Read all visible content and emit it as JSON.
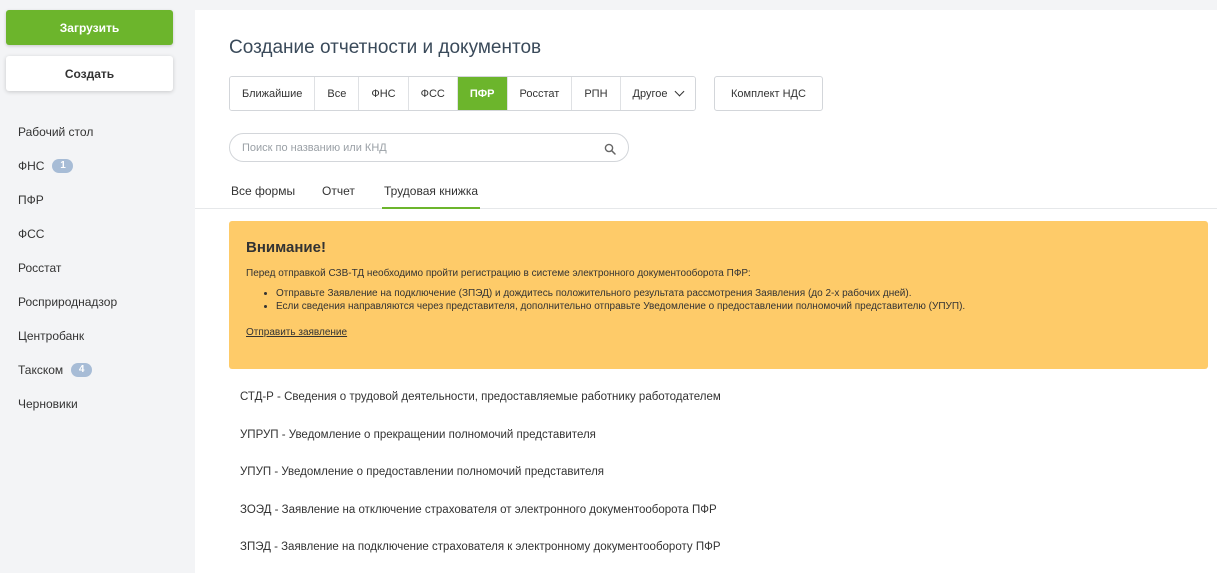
{
  "sidebar": {
    "upload_label": "Загрузить",
    "create_label": "Создать",
    "items": [
      {
        "label": "Рабочий стол",
        "badge": ""
      },
      {
        "label": "ФНС",
        "badge": "1"
      },
      {
        "label": "ПФР",
        "badge": ""
      },
      {
        "label": "ФСС",
        "badge": ""
      },
      {
        "label": "Росстат",
        "badge": ""
      },
      {
        "label": "Росприроднадзор",
        "badge": ""
      },
      {
        "label": "Центробанк",
        "badge": ""
      },
      {
        "label": "Такском",
        "badge": "4"
      },
      {
        "label": "Черновики",
        "badge": ""
      }
    ]
  },
  "main": {
    "title": "Создание отчетности и документов",
    "tabs": [
      "Ближайшие",
      "Все",
      "ФНС",
      "ФСС",
      "ПФР",
      "Росстат",
      "РПН",
      "Другое"
    ],
    "active_tab": "ПФР",
    "vat_tab": "Комплект НДС",
    "search_placeholder": "Поиск по названию или КНД",
    "subtabs": [
      "Все формы",
      "Отчет",
      "Трудовая книжка"
    ],
    "active_subtab": "Трудовая книжка",
    "alert": {
      "title": "Внимание!",
      "text": "Перед отправкой СЗВ-ТД необходимо пройти регистрацию в системе электронного документооборота ПФР:",
      "items": [
        "Отправьте Заявление на подключение (ЗПЭД) и дождитесь положительного результата рассмотрения Заявления (до 2-х рабочих дней).",
        "Если сведения направляются через представителя, дополнительно отправьте Уведомление о предоставлении полномочий представителю (УПУП)."
      ],
      "link": "Отправить заявление"
    },
    "documents": [
      "СТД-Р - Сведения о трудовой деятельности, предоставляемые работнику работодателем",
      "УПРУП - Уведомление о прекращении полномочий представителя",
      "УПУП - Уведомление о предоставлении полномочий представителя",
      "ЗОЭД - Заявление на отключение страхователя от электронного документооборота ПФР",
      "ЗПЭД - Заявление на подключение страхователя к электронному документообороту ПФР"
    ]
  },
  "colors": {
    "accent": "#6cb52c",
    "alert_bg": "#fecb69",
    "badge": "#a7bcd6"
  }
}
